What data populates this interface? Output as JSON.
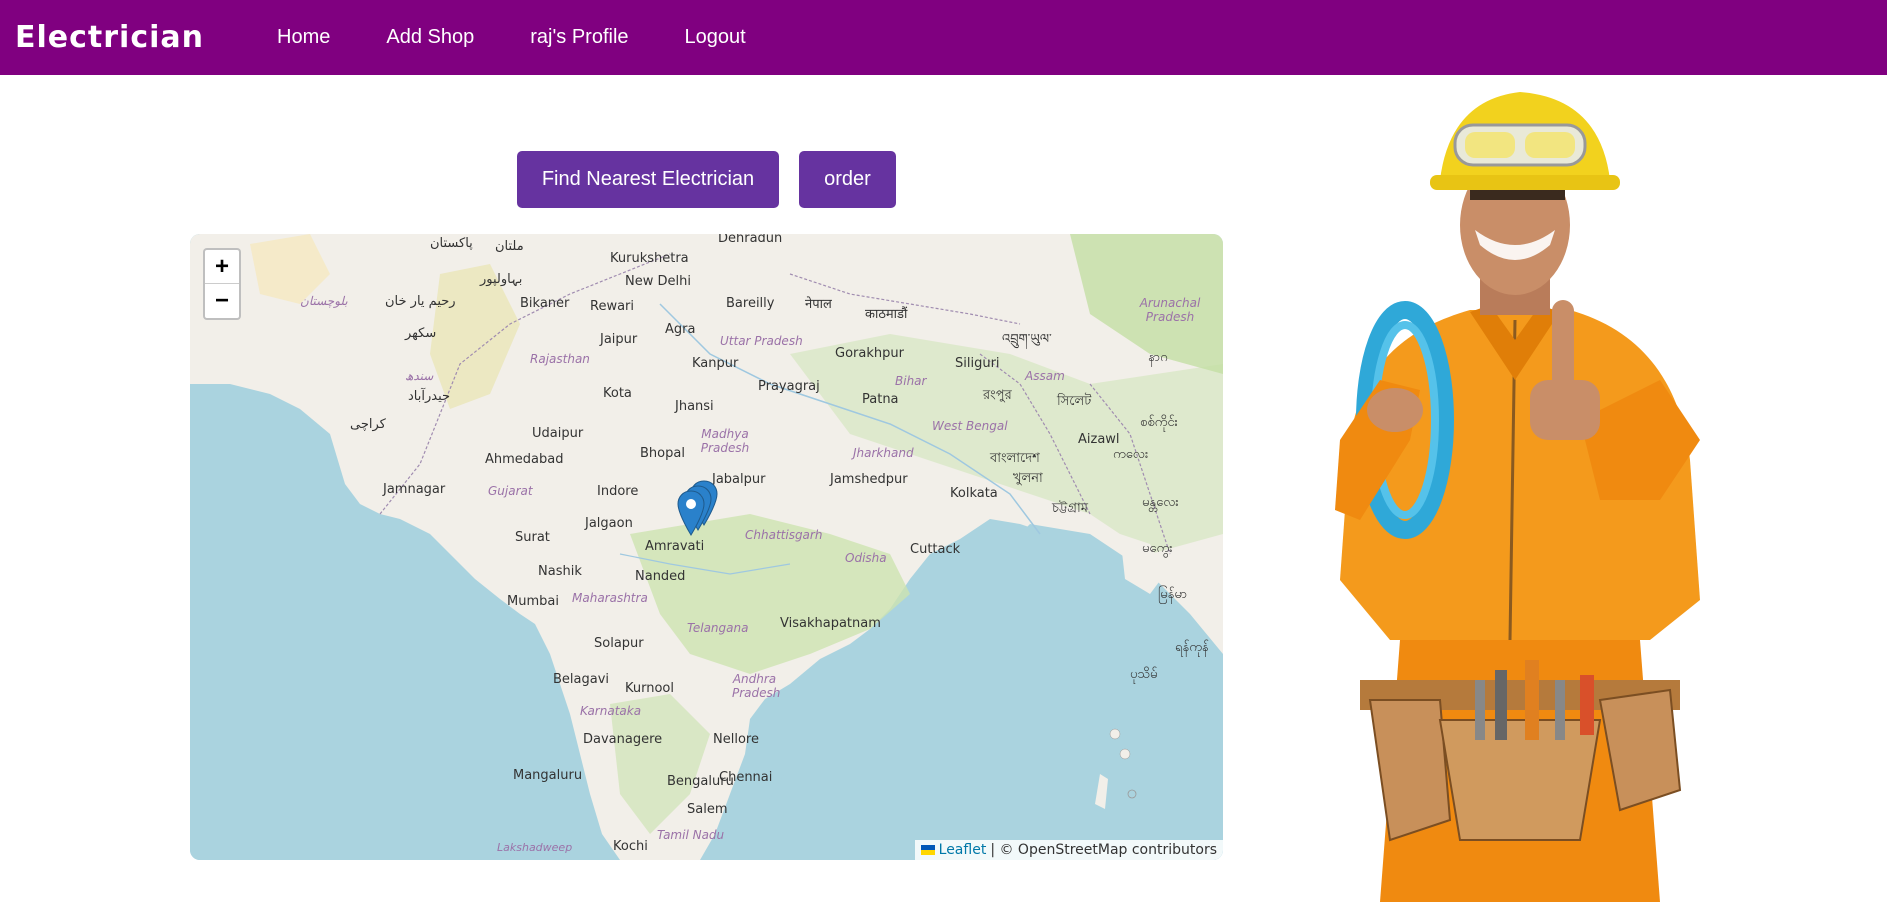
{
  "navbar": {
    "brand": "Electrician",
    "links": [
      "Home",
      "Add Shop",
      "raj's Profile",
      "Logout"
    ],
    "background": "#800080"
  },
  "actions": {
    "find_label": "Find Nearest Electrician",
    "order_label": "order",
    "button_color": "#6633a0"
  },
  "map": {
    "zoom_in": "+",
    "zoom_out": "−",
    "attribution": {
      "leaflet": "Leaflet",
      "separator": " | © OpenStreetMap contributors"
    },
    "labels": {
      "dehradun": "Dehradun",
      "kurukshetra": "Kurukshetra",
      "new_delhi": "New Delhi",
      "bareilly": "Bareilly",
      "kathmandu": "काठमाडौं",
      "nepal": "नेपाल",
      "pakistan": "پاکستان",
      "multan": "ملتان",
      "bahawalpur": "بہاولپور",
      "balochistan": "بلوچستان",
      "rahim": "رحیم یار خان",
      "sukkur": "سکھر",
      "sindh": "سندھ",
      "hyderabad_pk": "حیدرآباد",
      "karachi": "کراچی",
      "bikaner": "Bikaner",
      "rewari": "Rewari",
      "agra": "Agra",
      "jaipur": "Jaipur",
      "uttar_pradesh": "Uttar Pradesh",
      "gorakhpur": "Gorakhpur",
      "siliguri": "Siliguri",
      "bhutan": "འབྲུག་ཡུལ་",
      "arunachal": "Arunachal Pradesh",
      "rajasthan": "Rajasthan",
      "kanpur": "Kanpur",
      "bihar": "Bihar",
      "assam": "Assam",
      "kota": "Kota",
      "prayagraj": "Prayagraj",
      "rangpur": "রংপুর",
      "sylhet": "সিলেট",
      "jhansi": "Jhansi",
      "patna": "Patna",
      "udaipur": "Udaipur",
      "madhya_pradesh": "Madhya Pradesh",
      "west_bengal": "West Bengal",
      "aizawl": "Aizawl",
      "ahmedabad": "Ahmedabad",
      "bhopal": "Bhopal",
      "jharkhand": "Jharkhand",
      "bangladesh": "বাংলাদেশ",
      "khulna": "খুলনা",
      "jamnagar": "Jamnagar",
      "gujarat": "Gujarat",
      "indore": "Indore",
      "jabalpur": "Jabalpur",
      "jamshedpur": "Jamshedpur",
      "kolkata": "Kolkata",
      "chittagong": "চট্টগ্রাম",
      "jalgaon": "Jalgaon",
      "chhattisgarh": "Chhattisgarh",
      "surat": "Surat",
      "amravati": "Amravati",
      "cuttack": "Cuttack",
      "odisha": "Odisha",
      "nashik": "Nashik",
      "nanded": "Nanded",
      "mumbai": "Mumbai",
      "maharashtra": "Maharashtra",
      "telangana": "Telangana",
      "visakhapatnam": "Visakhapatnam",
      "solapur": "Solapur",
      "belagavi": "Belagavi",
      "kurnool": "Kurnool",
      "andhra": "Andhra Pradesh",
      "karnataka": "Karnataka",
      "davanagere": "Davanagere",
      "nellore": "Nellore",
      "mangaluru": "Mangaluru",
      "bengaluru": "Bengaluru",
      "chennai": "Chennai",
      "salem": "Salem",
      "tamil_nadu": "Tamil Nadu",
      "lakshadweep": "Lakshadweep",
      "kochi": "Kochi",
      "myanmar1": "ကလေး",
      "myanmar2": "မန္တလေး",
      "myanmar3": "မကွေး",
      "myanmar4": "မြန်မာ",
      "myanmar5": "ရန်ကုန်",
      "myanmar6": "ပုသိမ်",
      "myanmar7": "စစ်ကိုင်း",
      "nagaland": "နာဂ"
    },
    "marker_color": "#2a81cb"
  },
  "hero": {
    "colors": {
      "suit": "#f08a10",
      "helmet": "#f2d21e",
      "cable": "#2fa8d8",
      "skin": "#c98e68",
      "belt": "#b57a3c"
    }
  }
}
